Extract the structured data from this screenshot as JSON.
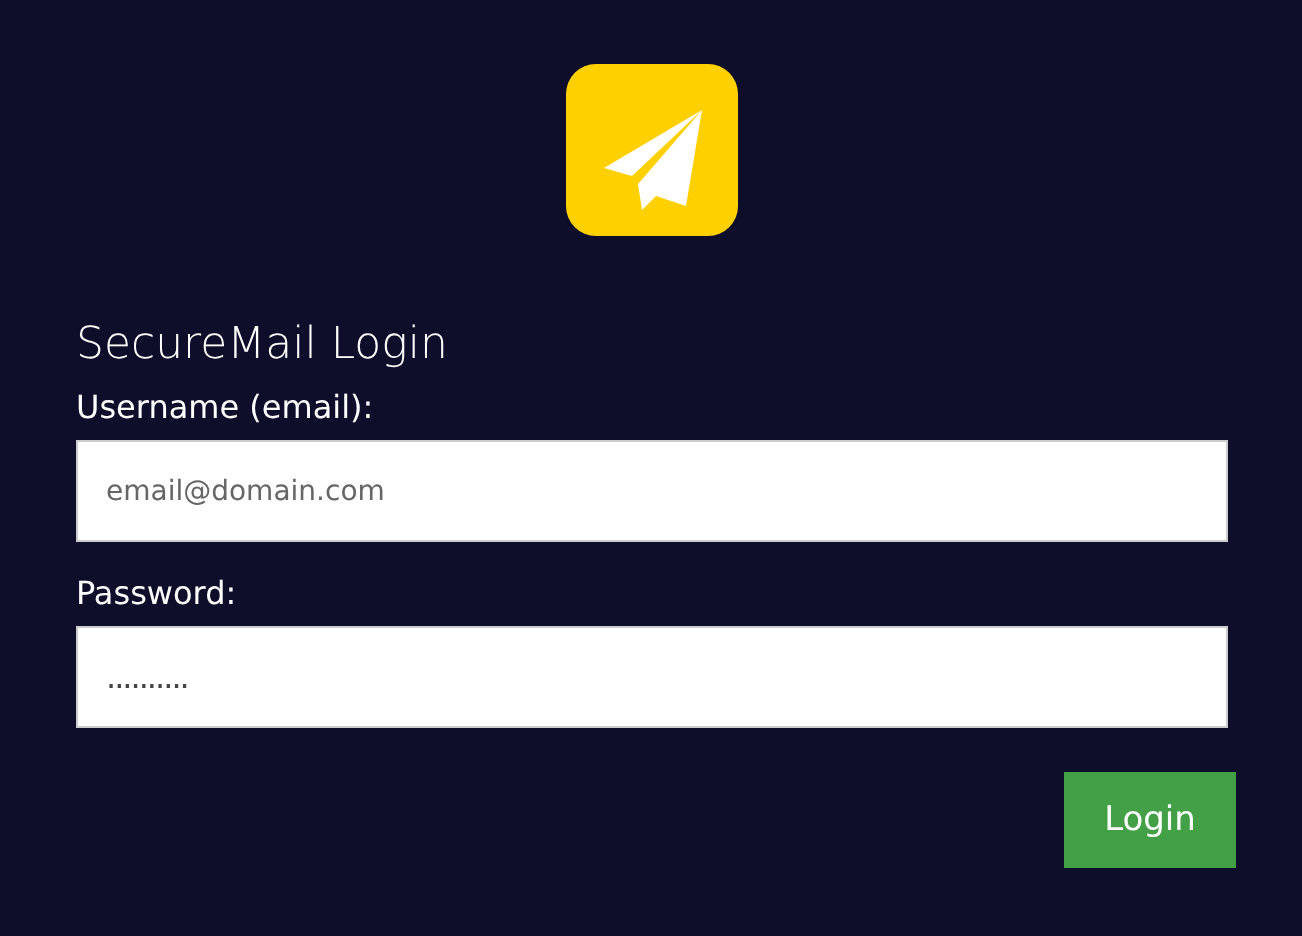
{
  "title": "SecureMail Login",
  "fields": [
    {
      "label": "Username (email):",
      "placeholder": "email@domain.com"
    },
    {
      "label": "Password:",
      "value": ".........."
    }
  ],
  "button": "Login"
}
